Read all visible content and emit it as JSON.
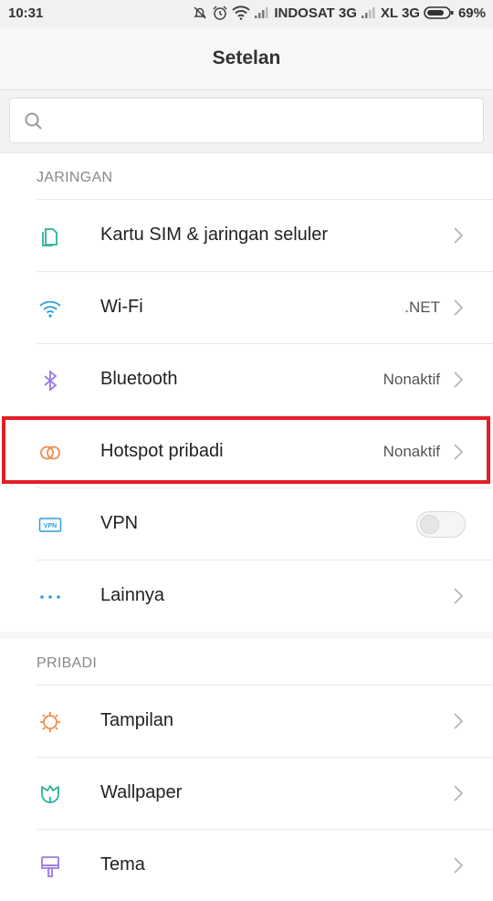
{
  "status_bar": {
    "time": "10:31",
    "carrier1": "INDOSAT 3G",
    "carrier2": "XL 3G",
    "battery": "69%",
    "icons": [
      "mute-bell-icon",
      "alarm-icon",
      "wifi-icon",
      "signal-icon",
      "signal-icon",
      "battery-icon"
    ]
  },
  "header": {
    "title": "Setelan"
  },
  "search": {
    "placeholder": ""
  },
  "sections": [
    {
      "header": "JARINGAN",
      "items": [
        {
          "label": "Kartu SIM & jaringan seluler",
          "value": "",
          "icon": "sim-card-icon",
          "color": "#2bb39a"
        },
        {
          "label": "Wi-Fi",
          "value": ".NET",
          "icon": "wifi-icon",
          "color": "#2a9fe0"
        },
        {
          "label": "Bluetooth",
          "value": "Nonaktif",
          "icon": "bluetooth-icon",
          "color": "#9b7be0"
        },
        {
          "label": "Hotspot pribadi",
          "value": "Nonaktif",
          "icon": "hotspot-icon",
          "color": "#f08a4b"
        },
        {
          "label": "VPN",
          "value": "",
          "icon": "vpn-icon",
          "color": "#2a9fe0",
          "toggle": false
        },
        {
          "label": "Lainnya",
          "value": "",
          "icon": "more-dots-icon",
          "color": "#2a9fe0"
        }
      ]
    },
    {
      "header": "PRIBADI",
      "items": [
        {
          "label": "Tampilan",
          "value": "",
          "icon": "sun-icon",
          "color": "#f08a4b"
        },
        {
          "label": "Wallpaper",
          "value": "",
          "icon": "tulip-icon",
          "color": "#2bb39a"
        },
        {
          "label": "Tema",
          "value": "",
          "icon": "brush-icon",
          "color": "#9b7be0"
        }
      ]
    }
  ],
  "highlight_color": "#e41e26"
}
